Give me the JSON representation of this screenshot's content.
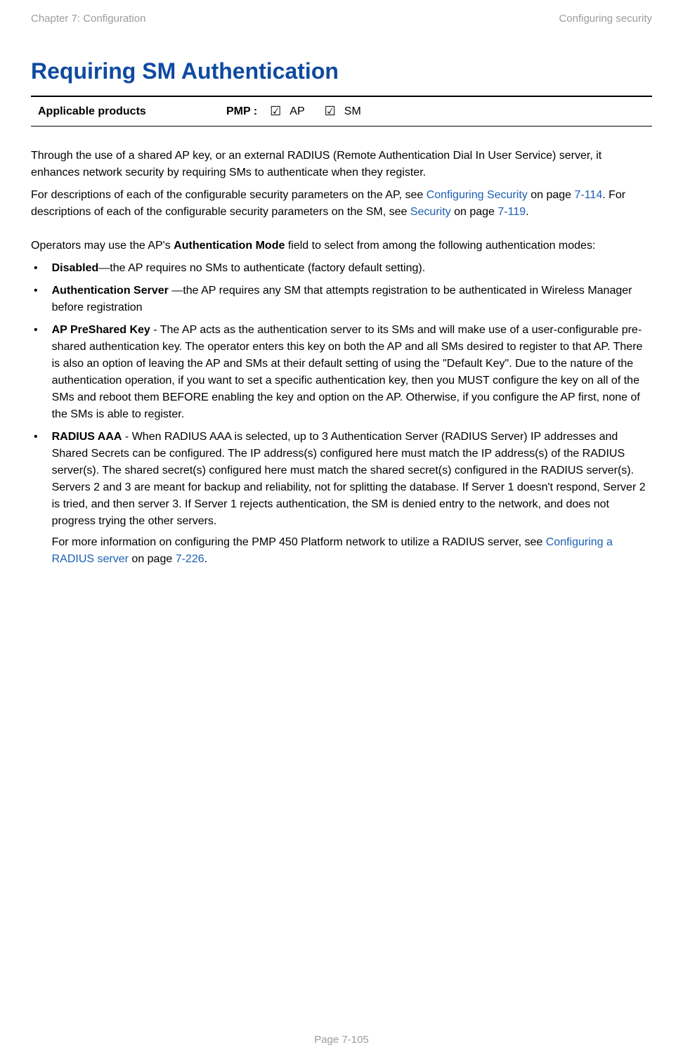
{
  "header": {
    "left": "Chapter 7:  Configuration",
    "right": "Configuring security"
  },
  "title": "Requiring SM Authentication",
  "applicable": {
    "label": "Applicable products",
    "prefix": "PMP :",
    "items": [
      {
        "symbol": "☑",
        "label": "AP"
      },
      {
        "symbol": "☑",
        "label": "SM"
      }
    ]
  },
  "paragraphs": {
    "p1": "Through the use of a shared AP key, or an external RADIUS (Remote Authentication Dial In User Service) server, it enhances network security by requiring SMs to authenticate when they register.",
    "p2_pre": "For descriptions of each of the configurable security parameters on the AP, see ",
    "p2_link1": "Configuring Security",
    "p2_mid1": " on page ",
    "p2_page1": "7-114",
    "p2_mid2": ". For descriptions of each of the configurable security parameters on the SM, see ",
    "p2_link2": "Security ",
    "p2_mid3": " on page ",
    "p2_page2": "7-119",
    "p2_end": ".",
    "p3_pre": "Operators may use the AP's ",
    "p3_bold": "Authentication Mode",
    "p3_post": " field to select from among the following authentication modes:"
  },
  "bullets": {
    "b1_bold": "Disabled",
    "b1_rest": "—the AP requires no SMs to authenticate (factory default setting).",
    "b2_bold": "Authentication Server ",
    "b2_rest": "—the AP requires any SM that attempts registration to be authenticated in Wireless Manager before registration",
    "b3_bold": "AP PreShared Key",
    "b3_rest": " - The AP acts as the authentication server to its SMs and will make use of a user-configurable pre-shared authentication key. The operator enters this key on both the AP and all SMs desired to register to that AP. There is also an option of leaving the AP and SMs at their default setting of using the \"Default Key\". Due to the nature of the authentication operation, if you want to set a specific authentication key, then you MUST configure the key on all of the SMs and reboot them BEFORE enabling the key and option on the AP. Otherwise, if you configure the AP first, none of the SMs is able to register.",
    "b4_bold": "RADIUS AAA",
    "b4_rest": " - When RADIUS AAA is selected, up to 3 Authentication Server (RADIUS Server) IP addresses and Shared Secrets can be configured. The IP address(s) configured here must match the IP address(s) of the RADIUS server(s). The shared secret(s) configured here must match the shared secret(s) configured in the RADIUS server(s). Servers 2 and 3 are meant for backup and reliability, not for splitting the database. If Server 1 doesn't respond, Server 2 is tried, and then server 3. If Server 1 rejects authentication, the SM is denied entry to the network, and does not progress trying the other servers.",
    "b4_extra_pre": "For more information on configuring the PMP 450 Platform network to utilize a RADIUS server, see ",
    "b4_extra_link": "Configuring a RADIUS server",
    "b4_extra_mid": " on page ",
    "b4_extra_page": "7-226",
    "b4_extra_end": "."
  },
  "footer": "Page 7-105"
}
